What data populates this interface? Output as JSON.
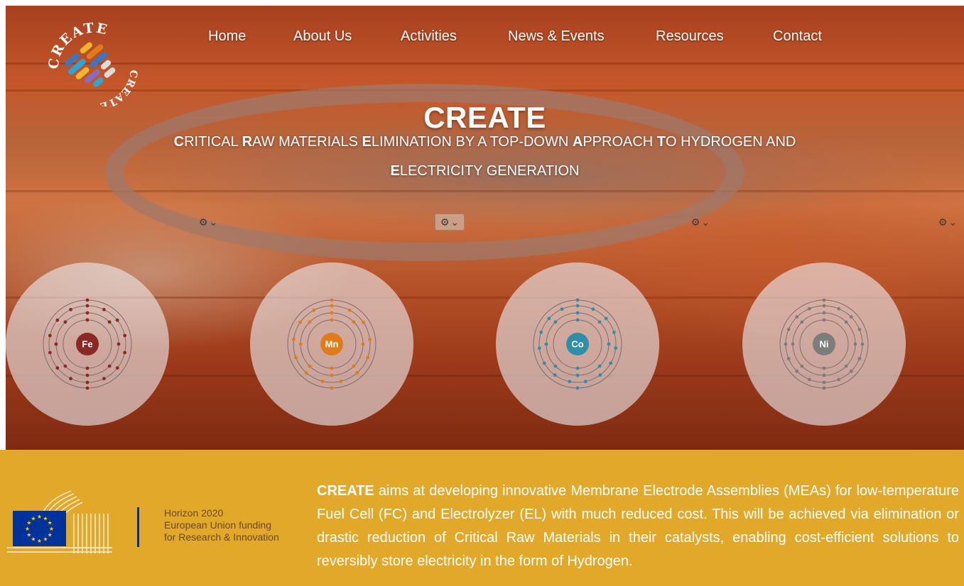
{
  "nav": {
    "items": [
      "Home",
      "About Us",
      "Activities",
      "News & Events",
      "Resources",
      "Contact"
    ]
  },
  "logo": {
    "text": "CREATE",
    "text_bottom": "CREATE"
  },
  "hero": {
    "title": "CREATE",
    "subtitle_line1": [
      {
        "b": "C",
        "t": "RITICAL "
      },
      {
        "b": "R",
        "t": "AW MATERIALS "
      },
      {
        "b": "E",
        "t": "LIMINATION BY A TOP-DOWN "
      },
      {
        "b": "A",
        "t": "PPROACH "
      },
      {
        "b": "T",
        "t": "O HYDROGEN AND"
      }
    ],
    "subtitle_line2": [
      {
        "b": "E",
        "t": "LECTRICITY GENERATION"
      }
    ]
  },
  "elements": [
    {
      "symbol": "Fe",
      "color": "#8b2a24",
      "shells": [
        2,
        8,
        14,
        2
      ]
    },
    {
      "symbol": "Mn",
      "color": "#e07b1a",
      "shells": [
        2,
        8,
        13,
        2
      ]
    },
    {
      "symbol": "Co",
      "color": "#2f8fa8",
      "shells": [
        2,
        8,
        15,
        2
      ]
    },
    {
      "symbol": "Ni",
      "color": "#7d7d7d",
      "shells": [
        2,
        8,
        16,
        2
      ]
    }
  ],
  "footer": {
    "horizon_line1": "Horizon 2020",
    "horizon_line2": "European Union funding",
    "horizon_line3": "for Research & Innovation",
    "desc_bold": "CREATE",
    "desc_rest": " aims at developing innovative Membrane Electrode Assemblies (MEAs) for low-temperature Fuel Cell (FC) and Electrolyzer (EL) with much reduced cost. This will be achieved via elimination or drastic reduction of Critical Raw Materials in their catalysts, enabling cost-efficient solutions to reversibly store electricity in the form of Hydrogen."
  },
  "colors": {
    "footer_bg": "#e1a82a",
    "eu_blue": "#003399",
    "eu_star": "#ffcc00"
  }
}
